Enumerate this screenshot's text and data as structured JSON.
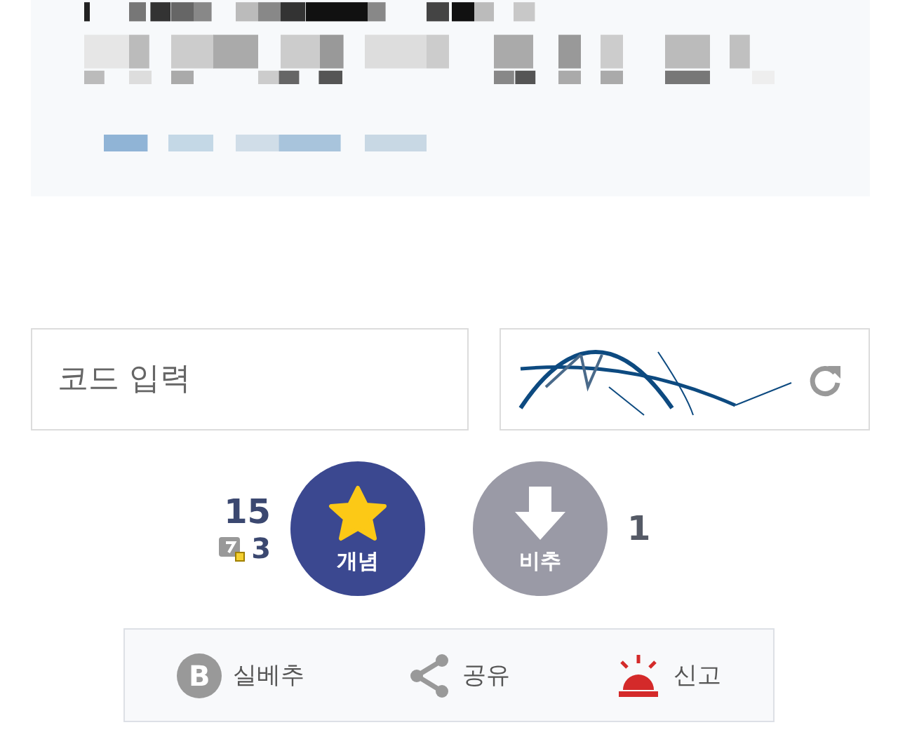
{
  "code_field": {
    "placeholder": "코드 입력"
  },
  "votes": {
    "up": {
      "count": "15",
      "fixed_count": "3",
      "label": "개념"
    },
    "down": {
      "count": "1",
      "label": "비추"
    }
  },
  "actions": [
    {
      "kind": "best",
      "icon_text": "B",
      "label": "실베추"
    },
    {
      "kind": "share",
      "label": "공유"
    },
    {
      "kind": "report",
      "label": "신고"
    }
  ]
}
